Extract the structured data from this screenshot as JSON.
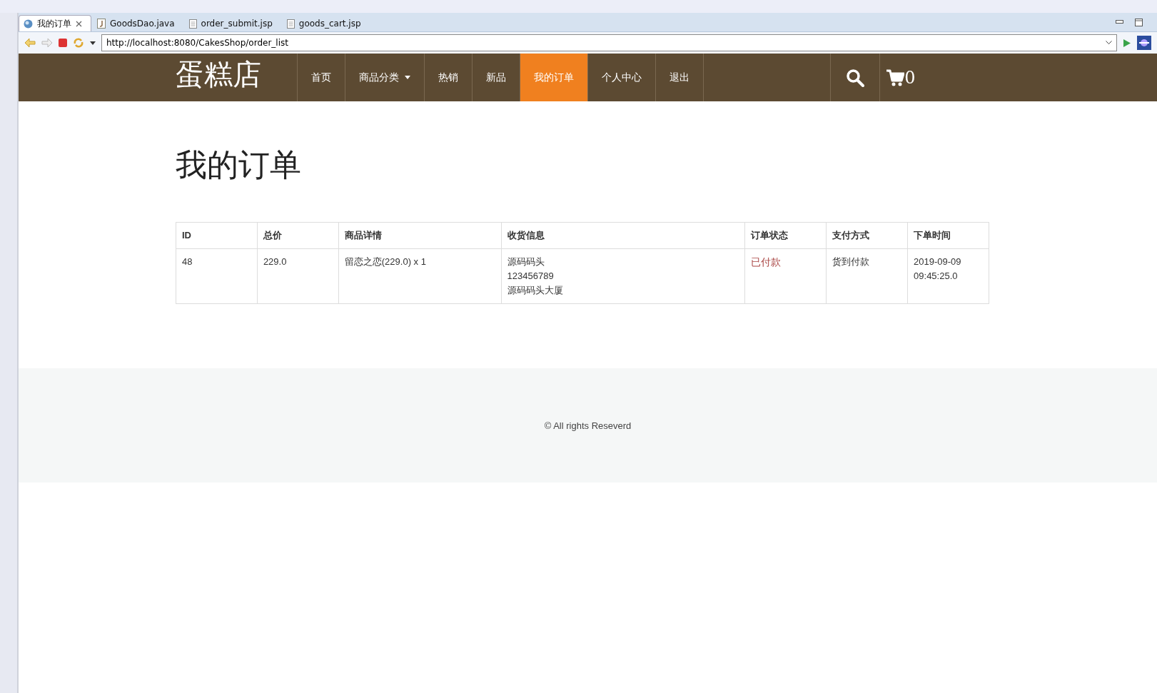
{
  "editor_tabs": [
    {
      "label": "我的订单",
      "kind": "browser",
      "selected": true
    },
    {
      "label": "GoodsDao.java",
      "kind": "java",
      "selected": false
    },
    {
      "label": "order_submit.jsp",
      "kind": "file",
      "selected": false
    },
    {
      "label": "goods_cart.jsp",
      "kind": "file",
      "selected": false
    }
  ],
  "address": {
    "value": "http://localhost:8080/CakesShop/order_list"
  },
  "site": {
    "brand": "蛋糕店",
    "nav": [
      {
        "label": "首页",
        "selected": false,
        "dropdown": false
      },
      {
        "label": "商品分类",
        "selected": false,
        "dropdown": true
      },
      {
        "label": "热销",
        "selected": false,
        "dropdown": false
      },
      {
        "label": "新品",
        "selected": false,
        "dropdown": false
      },
      {
        "label": "我的订单",
        "selected": true,
        "dropdown": false
      },
      {
        "label": "个人中心",
        "selected": false,
        "dropdown": false
      },
      {
        "label": "退出",
        "selected": false,
        "dropdown": false
      }
    ],
    "cart_count": "0"
  },
  "page_title": "我的订单",
  "table": {
    "columns": [
      "ID",
      "总价",
      "商品详情",
      "收货信息",
      "订单状态",
      "支付方式",
      "下单时间"
    ],
    "rows": [
      {
        "id": "48",
        "total": "229.0",
        "items": "留恋之恋(229.0) x 1",
        "shipping": [
          "源码码头",
          "123456789",
          "源码码头大厦"
        ],
        "status": "已付款",
        "color": "#a94442",
        "payment": "货到付款",
        "time": [
          "2019-09-09",
          "09:45:25.0"
        ]
      }
    ]
  },
  "footer": "© All rights Reseverd"
}
